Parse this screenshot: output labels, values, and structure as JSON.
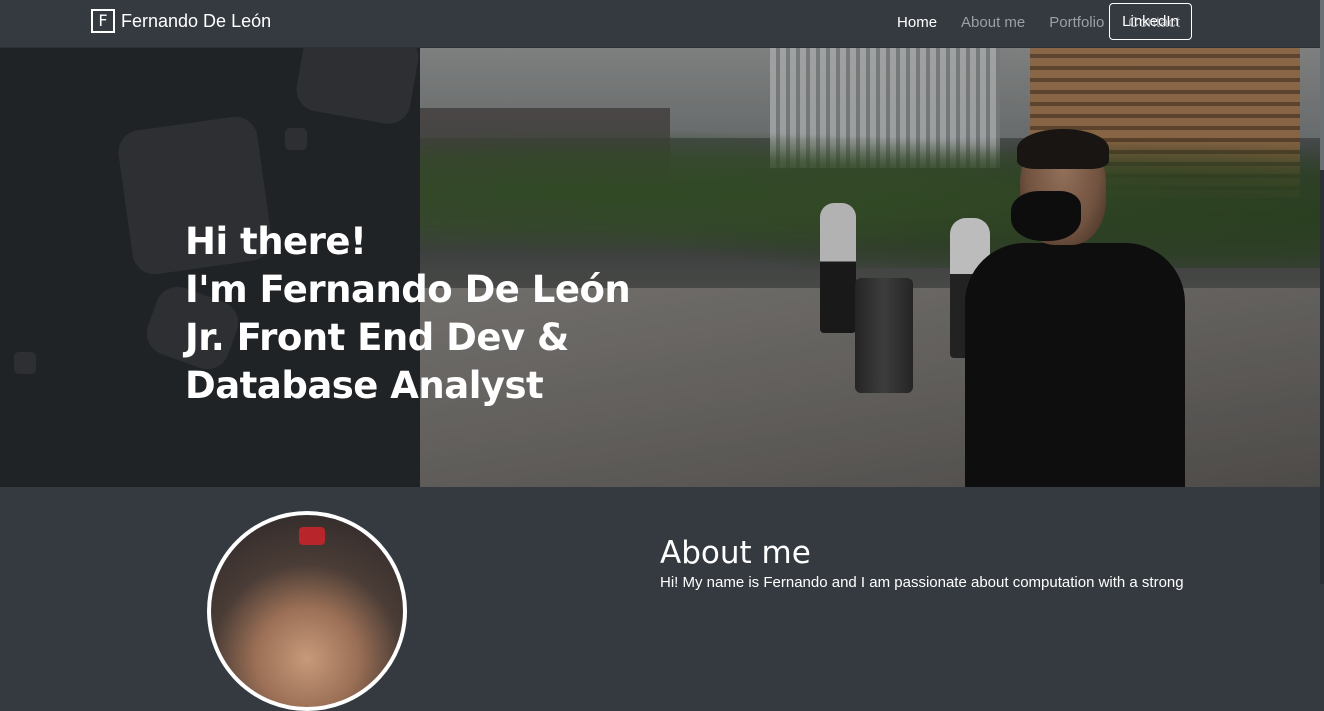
{
  "navbar": {
    "logo_letter": "F",
    "brand_name": "Fernando De León",
    "links": [
      {
        "label": "Home",
        "active": true
      },
      {
        "label": "About me",
        "active": false
      },
      {
        "label": "Portfolio",
        "active": false
      },
      {
        "label": "Contact",
        "active": false
      }
    ],
    "cta_label": "LinkedIn"
  },
  "hero": {
    "lines": [
      "Hi there!",
      "I'm Fernando De León",
      "Jr. Front End Dev &",
      "Database Analyst"
    ]
  },
  "about": {
    "title": "About me",
    "text": "Hi! My name is Fernando and I am passionate about computation with a strong"
  },
  "colors": {
    "navbar_bg": "#343a40",
    "hero_left_bg": "#202326",
    "text": "#ffffff",
    "nav_inactive": "#9aa0a6"
  }
}
